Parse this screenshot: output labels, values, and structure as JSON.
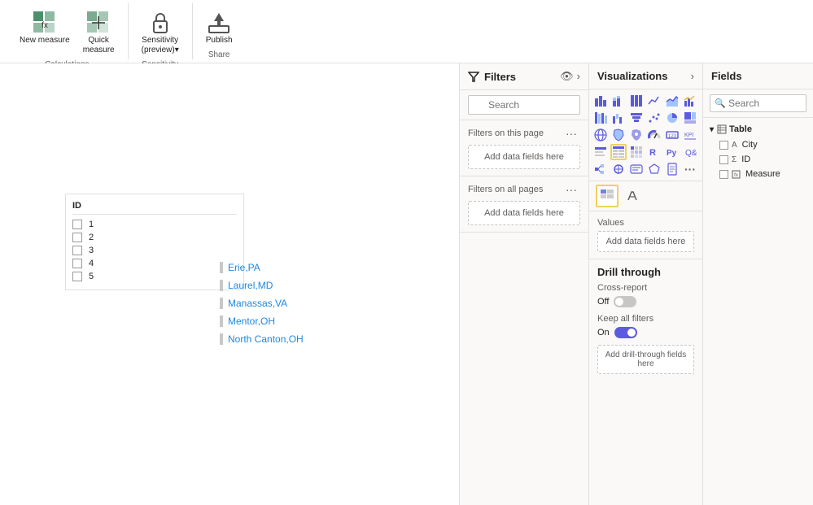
{
  "toolbar": {
    "groups": [
      {
        "name": "Calculations",
        "buttons": [
          {
            "id": "new-measure",
            "label": "New\nmeasure",
            "icon": "⊞"
          },
          {
            "id": "quick-measure",
            "label": "Quick\nmeasure",
            "icon": "⊟"
          }
        ]
      },
      {
        "name": "Sensitivity",
        "buttons": [
          {
            "id": "sensitivity",
            "label": "Sensitivity\n(preview)▾",
            "icon": "🔒"
          }
        ]
      },
      {
        "name": "Share",
        "buttons": [
          {
            "id": "publish",
            "label": "Publish",
            "icon": "📤"
          }
        ]
      }
    ]
  },
  "canvas": {
    "table": {
      "columns": [
        "ID"
      ],
      "rows": [
        {
          "id": "1"
        },
        {
          "id": "2"
        },
        {
          "id": "3"
        },
        {
          "id": "4"
        },
        {
          "id": "5"
        }
      ]
    },
    "cities": [
      "Erie,PA",
      "Laurel,MD",
      "Manassas,VA",
      "Mentor,OH",
      "North Canton,OH"
    ]
  },
  "filters": {
    "title": "Filters",
    "search_placeholder": "Search",
    "filters_this_page_label": "Filters on this page",
    "filters_this_page_add": "Add data fields here",
    "filters_all_pages_label": "Filters on all pages",
    "filters_all_pages_add": "Add data fields here"
  },
  "visualizations": {
    "title": "Visualizations",
    "icons": [
      "bar",
      "stacked-bar",
      "100-bar",
      "line",
      "area",
      "stacked-area",
      "scatter",
      "map",
      "filled-map",
      "pie",
      "donut",
      "funnel",
      "gauge",
      "card",
      "kpi",
      "slicer",
      "table",
      "matrix",
      "treemap",
      "waterfall",
      "r-visual",
      "py-visual",
      "qa",
      "more",
      "ribbon",
      "decomp",
      "key-influencers",
      "smart-narr",
      "shape-map",
      "azure-map",
      "custom1",
      "custom2",
      "more2"
    ],
    "active_icon": "table",
    "values_label": "Values",
    "values_add": "Add data fields here",
    "drill_through": {
      "title": "Drill through",
      "cross_report_label": "Cross-report",
      "cross_report_state": "Off",
      "cross_report_toggle": "off",
      "keep_all_filters_label": "Keep all filters",
      "keep_all_filters_state": "On",
      "keep_all_filters_toggle": "on",
      "add_drill_label": "Add drill-through fields here"
    }
  },
  "fields": {
    "title": "Fields",
    "search_placeholder": "Search",
    "table_name": "Table",
    "items": [
      {
        "id": "city",
        "label": "City",
        "type": "text",
        "sigma": false
      },
      {
        "id": "id",
        "label": "ID",
        "type": "sigma",
        "sigma": true
      },
      {
        "id": "measure",
        "label": "Measure",
        "type": "measure",
        "sigma": false
      }
    ]
  }
}
